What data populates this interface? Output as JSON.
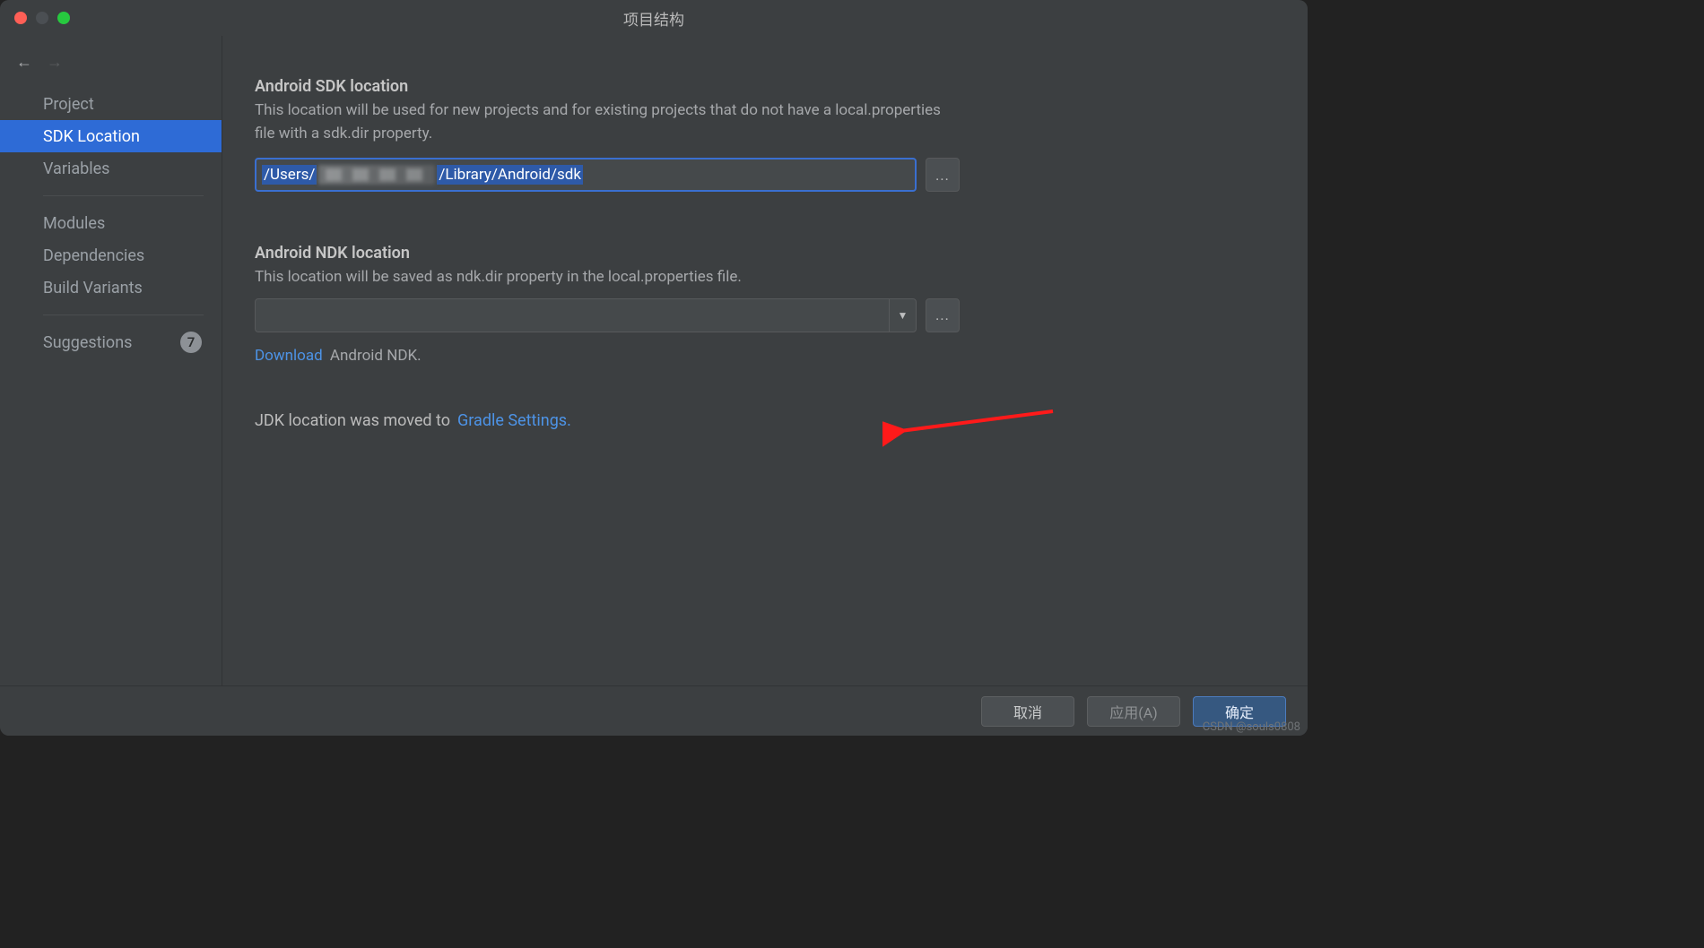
{
  "window": {
    "title": "项目结构"
  },
  "sidebar": {
    "items": [
      {
        "label": "Project"
      },
      {
        "label": "SDK Location"
      },
      {
        "label": "Variables"
      },
      {
        "label": "Modules"
      },
      {
        "label": "Dependencies"
      },
      {
        "label": "Build Variants"
      },
      {
        "label": "Suggestions"
      }
    ],
    "suggestions_badge": "7"
  },
  "sdk": {
    "title": "Android SDK location",
    "desc": "This location will be used for new projects and for existing projects that do not have a local.properties file with a sdk.dir property.",
    "path_prefix": "/Users/",
    "path_suffix": "/Library/Android/sdk",
    "browse": "..."
  },
  "ndk": {
    "title": "Android NDK location",
    "desc": "This location will be saved as ndk.dir property in the local.properties file.",
    "value": "",
    "browse": "...",
    "download_link": "Download",
    "download_rest": " Android NDK."
  },
  "jdk": {
    "prefix": "JDK location was moved to ",
    "link": "Gradle Settings."
  },
  "footer": {
    "cancel": "取消",
    "apply": "应用(A)",
    "ok": "确定"
  },
  "watermark": "CSDN @souls0808"
}
